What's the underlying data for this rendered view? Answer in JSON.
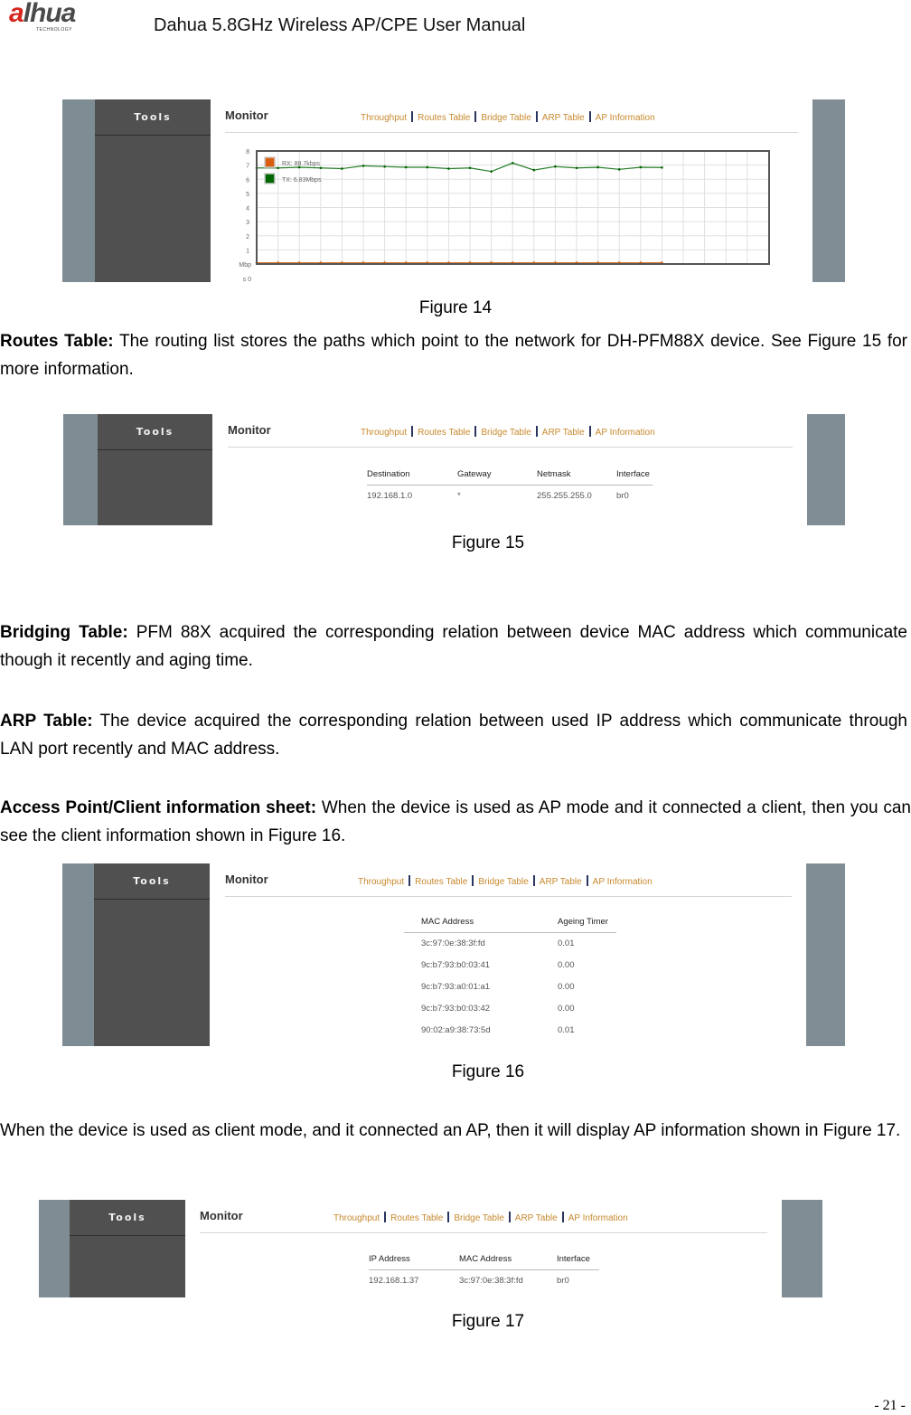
{
  "header": {
    "logo_text_a": "a",
    "logo_text_rest": "lhua",
    "logo_sub": "TECHNOLOGY",
    "title": "Dahua 5.8GHz Wireless AP/CPE User Manual"
  },
  "ui": {
    "sidebar_title": "Tools",
    "section_title": "Monitor",
    "tabs": [
      "Throughput",
      "Routes Table",
      "Bridge Table",
      "ARP Table",
      "AP Information"
    ]
  },
  "figure14": {
    "caption": "Figure 14",
    "chart_data": {
      "type": "line",
      "title": "",
      "ylabel": "Mbps",
      "xlabel": "",
      "ylim": [
        0,
        8
      ],
      "yticks": [
        "8",
        "7",
        "6",
        "5",
        "4",
        "3",
        "2",
        "1",
        "Mbps 0"
      ],
      "grid": true,
      "legend": "top-left",
      "series": [
        {
          "name": "RX: 88.7kbps",
          "color": "#d95f0e",
          "values": [
            0.09,
            0.09,
            0.09,
            0.09,
            0.09,
            0.09,
            0.09,
            0.09,
            0.09,
            0.09,
            0.09,
            0.09,
            0.09,
            0.09,
            0.09,
            0.09,
            0.09,
            0.09,
            0.09,
            0.09
          ]
        },
        {
          "name": "TX: 6.83Mbps",
          "color": "#006600",
          "values": [
            6.8,
            6.8,
            6.85,
            6.8,
            6.75,
            6.95,
            6.9,
            6.85,
            6.85,
            6.75,
            6.8,
            6.55,
            7.15,
            6.65,
            6.9,
            6.8,
            6.85,
            6.7,
            6.85,
            6.83
          ]
        }
      ]
    }
  },
  "routes_para": {
    "bold": "Routes Table:",
    "text": " The routing list stores the paths which point to the network for DH-PFM88X device. See Figure 15 for more information."
  },
  "figure15": {
    "caption": "Figure 15",
    "headers": [
      "Destination",
      "Gateway",
      "Netmask",
      "Interface"
    ],
    "rows": [
      [
        "192.168.1.0",
        "*",
        "255.255.255.0",
        "br0"
      ]
    ]
  },
  "bridging_para": {
    "bold": "Bridging Table:",
    "text": " PFM 88X acquired the corresponding relation between device MAC address which communicate though it recently and aging time."
  },
  "arp_para": {
    "bold": "ARP Table:",
    "text": " The device acquired the corresponding relation between used IP address which communicate through LAN port recently and MAC address."
  },
  "ap_para": {
    "bold": "Access Point/Client information sheet:",
    "text": " When the device is used as AP mode and it connected a client, then you can see the client information shown in Figure 16."
  },
  "figure16": {
    "caption": "Figure 16",
    "headers": [
      "MAC Address",
      "Ageing Timer"
    ],
    "rows": [
      [
        "3c:97:0e:38:3f:fd",
        "0.01"
      ],
      [
        "9c:b7:93:b0:03:41",
        "0.00"
      ],
      [
        "9c:b7:93:a0:01:a1",
        "0.00"
      ],
      [
        "9c:b7:93:b0:03:42",
        "0.00"
      ],
      [
        "90:02:a9:38:73:5d",
        "0.01"
      ]
    ]
  },
  "client_para": {
    "text": "When the device is used as client mode, and it connected an AP, then it will display AP information shown in Figure 17."
  },
  "figure17": {
    "caption": "Figure 17",
    "headers": [
      "IP Address",
      "MAC Address",
      "Interface"
    ],
    "rows": [
      [
        "192.168.1.37",
        "3c:97:0e:38:3f:fd",
        "br0"
      ]
    ]
  },
  "footer": {
    "page_number": "- 21 -"
  }
}
